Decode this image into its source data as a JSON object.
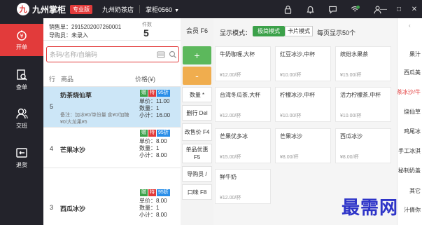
{
  "header": {
    "logo_glyph": "九",
    "app_name": "九州掌柜",
    "edition": "专业版",
    "store": "九州奶茶店",
    "account": "掌柜0560",
    "account_caret": "▼",
    "icons": [
      "lock-icon",
      "bell-icon",
      "chat-icon",
      "wifi-icon",
      "user-icon"
    ],
    "window_controls": [
      "—",
      "□",
      "✕"
    ]
  },
  "nav": [
    {
      "label": "开单",
      "icon": "cashier-icon",
      "active": true
    },
    {
      "label": "查单",
      "icon": "receipt-search-icon",
      "active": false
    },
    {
      "label": "交班",
      "icon": "users-icon",
      "active": false
    },
    {
      "label": "退货",
      "icon": "return-icon",
      "active": false
    }
  ],
  "order": {
    "order_no": "销售单：2915202007260001",
    "staff": "导购员：未录入",
    "count_label": "件数",
    "count": "5",
    "search_placeholder": "条码/名称/自编码",
    "col_index": "行",
    "col_name": "商品",
    "col_price": "价格(¥)",
    "badges": {
      "give": "赠",
      "special": "特",
      "discount": "95折"
    },
    "rows": [
      {
        "index": "5",
        "name": "奶茶烧仙草",
        "note": "备注：加冰¥0/单份量 食¥0/加糖¥0/大龙果¥5",
        "price": "单价：11.00",
        "qty": "数量：1",
        "subtotal": "小计：16.00",
        "selected": true
      },
      {
        "index": "4",
        "name": "芒果冰沙",
        "note": "",
        "price": "单价：8.00",
        "qty": "数量：1",
        "subtotal": "小计：8.00",
        "selected": false
      },
      {
        "index": "3",
        "name": "西瓜冰沙",
        "note": "",
        "price": "单价：8.00",
        "qty": "数量：1",
        "subtotal": "小计：8.00",
        "selected": false
      }
    ]
  },
  "actions": {
    "member": "会员 F6",
    "plus": "+",
    "minus": "-",
    "quantity": "数量 *",
    "delete_row": "删行 Del",
    "change_price": "改售价 F4",
    "item_discount": "单品优惠 F5",
    "guide": "导购员 /",
    "flavor": "口味 F8"
  },
  "products": {
    "mode_label": "显示模式：",
    "mode_simple": "极简模式",
    "mode_card": "卡片模式",
    "per_page": "每页显示50个",
    "items": [
      {
        "name": "牛奶咖喱,大杯",
        "price": "¥12.00/杯"
      },
      {
        "name": "红豆冰沙,中杯",
        "price": "¥10.00/杯"
      },
      {
        "name": "缤纷水果茶",
        "price": "¥15.00/杯"
      },
      {
        "name": "台湾冬瓜茶,大杯",
        "price": "¥12.00/杯"
      },
      {
        "name": "柠檬冰沙,中杯",
        "price": "¥10.00/杯"
      },
      {
        "name": "活力柠檬茶,中杯",
        "price": "¥10.00/杯"
      },
      {
        "name": "芒果优多冰",
        "price": "¥15.00/杯"
      },
      {
        "name": "芒果冰沙",
        "price": "¥8.00/杯"
      },
      {
        "name": "西瓜冰沙",
        "price": "¥8.00/杯"
      },
      {
        "name": "鲜牛奶",
        "price": "¥12.00/杯"
      }
    ]
  },
  "categories": [
    "果汁",
    "西瓜美",
    "茶冰沙/牛",
    "烧仙草",
    "鸡尾冰",
    "手工冰淇",
    "秘制奶盖",
    "其它",
    "汁倩你"
  ],
  "watermark": "最需网",
  "colors": {
    "accent_red": "#e23b3b",
    "nav_dark": "#23232b",
    "green": "#3ca14a",
    "orange": "#f0ad4e",
    "selected_row": "#cce6f7",
    "watermark_blue": "#2e34c8"
  }
}
